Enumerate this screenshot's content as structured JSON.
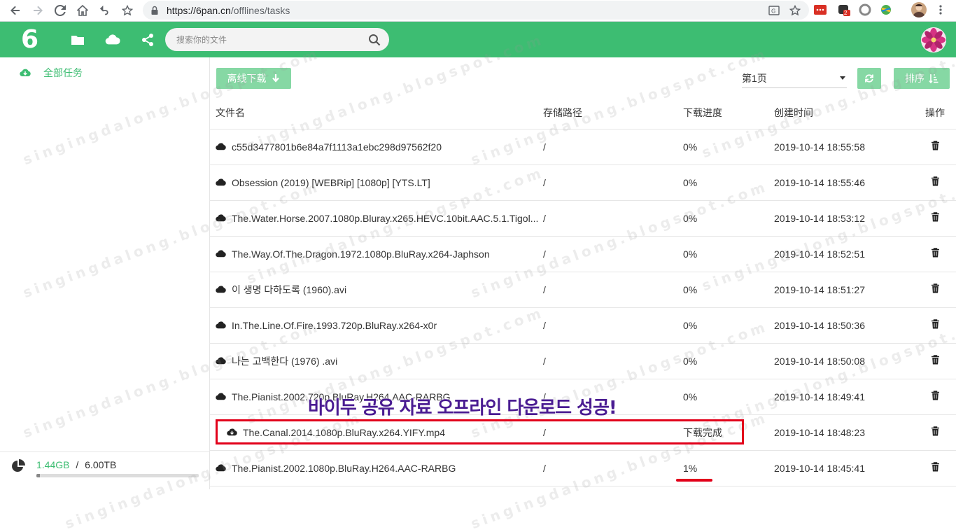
{
  "browser": {
    "url_host": "https://6pan.cn",
    "url_path": "/offlines/tasks",
    "ext_badge": "2"
  },
  "header": {
    "logo": "6",
    "search_placeholder": "搜索你的文件"
  },
  "sidebar": {
    "items": [
      {
        "label": "全部任务",
        "icon": "cloud-download-icon"
      }
    ],
    "storage": {
      "used": "1.44GB",
      "separator": "/",
      "total": "6.00TB",
      "used_fraction": 0.00024
    }
  },
  "toolbar": {
    "offline_download_label": "离线下载",
    "page_label": "第1页",
    "sort_label": "排序"
  },
  "table": {
    "headers": {
      "name": "文件名",
      "path": "存储路径",
      "progress": "下载进度",
      "created": "创建时间",
      "ops": "操作"
    },
    "rows": [
      {
        "name": "c55d3477801b6e84a7f1113a1ebc298d97562f20",
        "path": "/",
        "progress": "0%",
        "created": "2019-10-14 18:55:58",
        "icon": "cloud-icon"
      },
      {
        "name": "Obsession (2019) [WEBRip] [1080p] [YTS.LT]",
        "path": "/",
        "progress": "0%",
        "created": "2019-10-14 18:55:46",
        "icon": "cloud-icon"
      },
      {
        "name": "The.Water.Horse.2007.1080p.Bluray.x265.HEVC.10bit.AAC.5.1.Tigol...",
        "path": "/",
        "progress": "0%",
        "created": "2019-10-14 18:53:12",
        "icon": "cloud-icon"
      },
      {
        "name": "The.Way.Of.The.Dragon.1972.1080p.BluRay.x264-Japhson",
        "path": "/",
        "progress": "0%",
        "created": "2019-10-14 18:52:51",
        "icon": "cloud-icon"
      },
      {
        "name": "이 생명 다하도록 (1960).avi",
        "path": "/",
        "progress": "0%",
        "created": "2019-10-14 18:51:27",
        "icon": "cloud-icon"
      },
      {
        "name": "In.The.Line.Of.Fire.1993.720p.BluRay.x264-x0r",
        "path": "/",
        "progress": "0%",
        "created": "2019-10-14 18:50:36",
        "icon": "cloud-icon"
      },
      {
        "name": "나는 고백한다 (1976) .avi",
        "path": "/",
        "progress": "0%",
        "created": "2019-10-14 18:50:08",
        "icon": "cloud-icon"
      },
      {
        "name": "The.Pianist.2002.720p.BluRay.H264.AAC-RARBG",
        "path": "/",
        "progress": "0%",
        "created": "2019-10-14 18:49:41",
        "icon": "cloud-icon"
      },
      {
        "name": "The.Canal.2014.1080p.BluRay.x264.YIFY.mp4",
        "path": "/",
        "progress": "下载完成",
        "created": "2019-10-14 18:48:23",
        "icon": "cloud-download-icon"
      },
      {
        "name": "The.Pianist.2002.1080p.BluRay.H264.AAC-RARBG",
        "path": "/",
        "progress": "1%",
        "created": "2019-10-14 18:45:41",
        "icon": "cloud-icon"
      }
    ]
  },
  "annotation": {
    "caption": "바이두 공유 자료 오프라인 다운로드 성공!",
    "watermark": "singingdalong.blogspot.com"
  },
  "colors": {
    "brand": "#3dbd72",
    "button_light": "#86d8a4",
    "highlight": "#e2001a",
    "caption": "#4a1c92"
  }
}
